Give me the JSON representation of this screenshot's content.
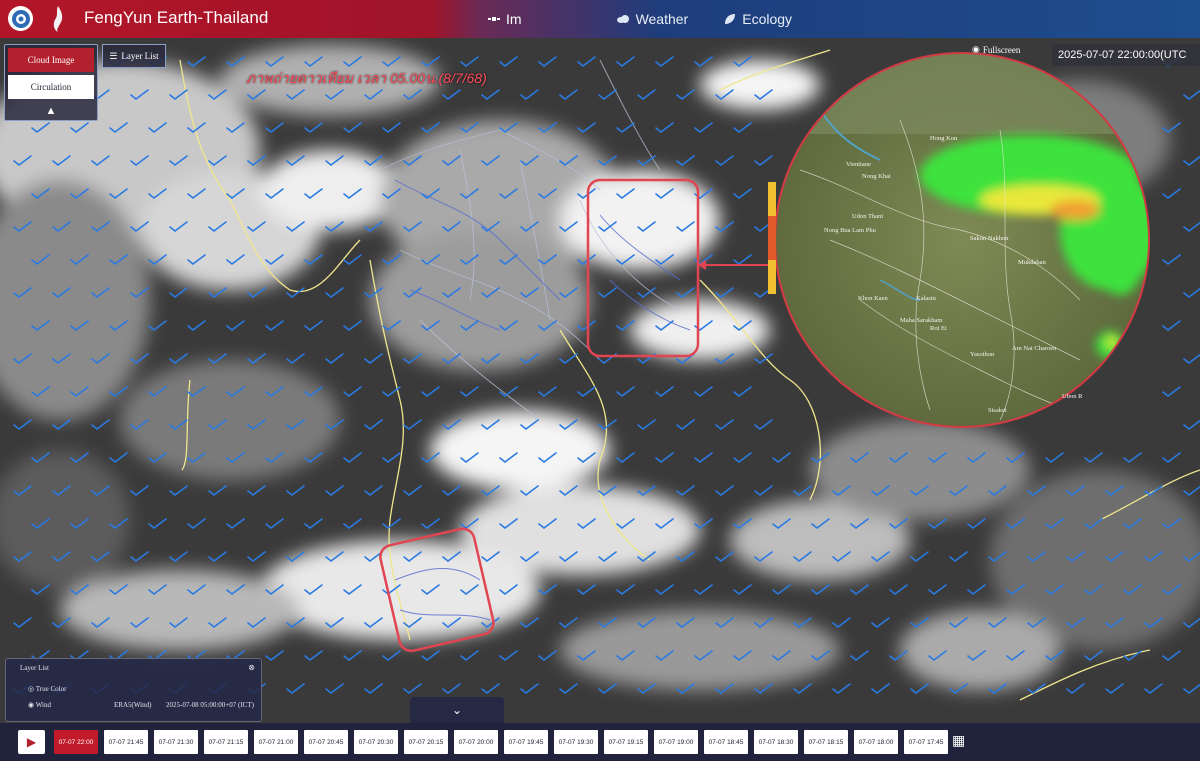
{
  "header": {
    "title": "FengYun Earth-Thailand",
    "tabs": [
      {
        "label": "Im",
        "icon": "satellite-icon"
      },
      {
        "label": "Weather",
        "icon": "cloud-icon"
      },
      {
        "label": "Ecology",
        "icon": "leaf-icon"
      }
    ],
    "colors": {
      "brand_red": "#b31528",
      "nav_blue": "#1e4e8e"
    }
  },
  "left_controls": {
    "cloud_image": "Cloud Image",
    "circulation": "Circulation",
    "layer_list_button": "Layer List"
  },
  "map": {
    "caption": "ภาพถ่ายดาวเทียม เวลา 05.00น.(8/7/68)",
    "fullscreen": "Fullscreen",
    "timestamp": "2025-07-07 22:00:00(UTC",
    "radar_places": [
      "Hong Kon",
      "Vientiane",
      "Nong Khai",
      "Udon Thani",
      "Nong Bua Lam Phu",
      "Sakon Nakhon",
      "Mukdahan",
      "Khon Kaen",
      "Kalasin",
      "Maha Sarakham",
      "Roi Et",
      "Yasothon",
      "Am Nat Charoen",
      "Ubon R",
      "Sisaket"
    ]
  },
  "layer_panel": {
    "heading": "Layer List",
    "row1": "True Color",
    "row2_label": "Wind",
    "row2_value": "ERA5(Wind)",
    "row2_time": "2025-07-08 05:00:00+07 (ICT)"
  },
  "timeline": {
    "times": [
      "07-07 22:00",
      "07-07 21:45",
      "07-07 21:30",
      "07-07 21:15",
      "07-07 21:00",
      "07-07 20:45",
      "07-07 20:30",
      "07-07 20:15",
      "07-07 20:00",
      "07-07 19:45",
      "07-07 19:30",
      "07-07 19:15",
      "07-07 19:00",
      "07-07 18:45",
      "07-07 18:30",
      "07-07 18:15",
      "07-07 18:00",
      "07-07 17:45"
    ],
    "active_index": 0
  }
}
